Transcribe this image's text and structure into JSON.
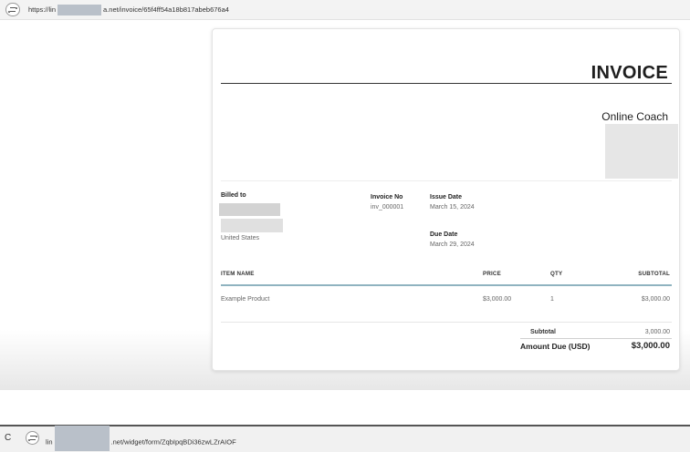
{
  "browser_top": {
    "url_prefix": "https://lin",
    "url_suffix": "a.net/invoice/65f4ff54a18b817abeb676a4"
  },
  "invoice": {
    "title": "INVOICE",
    "business_name": "Online Coach",
    "billed_to": {
      "label": "Billed to",
      "country": "United States"
    },
    "invoice_no": {
      "label": "Invoice No",
      "value": "inv_000001"
    },
    "issue_date": {
      "label": "Issue Date",
      "value": "March 15, 2024"
    },
    "due_date": {
      "label": "Due Date",
      "value": "March 29, 2024"
    },
    "table": {
      "headers": [
        "ITEM NAME",
        "PRICE",
        "QTY",
        "SUBTOTAL"
      ],
      "rows": [
        {
          "item": "Example Product",
          "price": "$3,000.00",
          "qty": "1",
          "subtotal": "$3,000.00"
        }
      ]
    },
    "totals": {
      "subtotal_label": "Subtotal",
      "subtotal_value": "3,000.00",
      "amount_due_label": "Amount Due (USD)",
      "amount_due_value": "$3,000.00"
    }
  },
  "browser_bottom": {
    "reload_glyph": "C",
    "url_prefix": "lin",
    "url_suffix": ".net/widget/form/ZqbIpqBDi36zwLZrAIOF"
  },
  "icons": {
    "site_info": "site-settings-icon",
    "reload": "reload-icon"
  }
}
